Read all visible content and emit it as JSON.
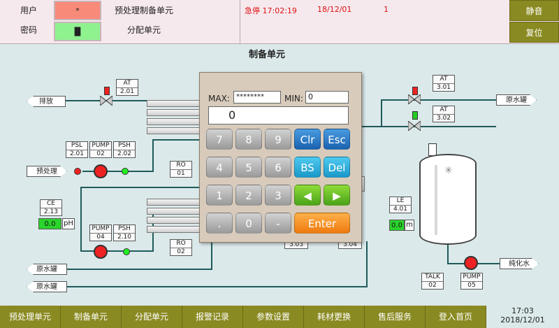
{
  "header": {
    "user_label": "用户",
    "user_value": "*",
    "password_label": "密码",
    "password_value": "█",
    "pre_unit_label": "预处理制备单元",
    "dist_unit_label": "分配单元",
    "alarm_text": "急停 17:02:19",
    "alarm_date": "18/12/01",
    "alarm_count": "1",
    "mute_button": "静音",
    "reset_button": "复位"
  },
  "process": {
    "title": "制备单元",
    "tags": {
      "drain": "排放",
      "pretreat": "预处理",
      "raw_tank_1": "原水罐",
      "raw_tank_2": "原水罐",
      "raw_tank_right": "原水罐",
      "pure_water": "纯化水"
    },
    "instruments": {
      "at_1": {
        "name": "AT",
        "value": "2.01"
      },
      "psl": {
        "name": "PSL",
        "value": "2.01"
      },
      "pump_02": {
        "name": "PUMP",
        "value": "02"
      },
      "psh_202": {
        "name": "PSH",
        "value": "2.02"
      },
      "ro_01": {
        "name": "RO",
        "value": "01"
      },
      "ce": {
        "name": "CE",
        "value": "2.13"
      },
      "pump_04": {
        "name": "PUMP",
        "value": "04"
      },
      "psh_210": {
        "name": "PSH",
        "value": "2.10"
      },
      "ro_02": {
        "name": "RO",
        "value": "02"
      },
      "at_301": {
        "name": "AT",
        "value": "3.01"
      },
      "at_302": {
        "name": "AT",
        "value": "3.02"
      },
      "le": {
        "name": "LE",
        "value": "4.01"
      },
      "talk": {
        "name": "TALK",
        "value": "02"
      },
      "pump_05": {
        "name": "PUMP",
        "value": "05"
      },
      "partial_303": "3.03",
      "partial_304": "3.04"
    },
    "ce_value": "0.0",
    "ce_unit": "pH",
    "le_value": "0.0",
    "le_unit": "m"
  },
  "keypad": {
    "max_label": "MAX:",
    "max_value": "********",
    "min_label": "MIN:",
    "min_value": "0",
    "display_value": "0",
    "keys": {
      "k7": "7",
      "k8": "8",
      "k9": "9",
      "clr": "Clr",
      "esc": "Esc",
      "k4": "4",
      "k5": "5",
      "k6": "6",
      "bs": "BS",
      "del": "Del",
      "k1": "1",
      "k2": "2",
      "k3": "3",
      "left": "◀",
      "right": "▶",
      "dot": ".",
      "k0": "0",
      "minus": "-",
      "enter": "Enter"
    }
  },
  "nav": {
    "items": [
      "预处理单元",
      "制备单元",
      "分配单元",
      "报警记录",
      "参数设置",
      "耗材更换",
      "售后服务",
      "登入首页"
    ],
    "time": "17:03",
    "date": "2018/12/01"
  },
  "colors": {
    "accent": "#8a8a22",
    "header_bg": "#f6e9ee",
    "canvas_bg": "#dbe9ea",
    "user_field": "#f88a7a",
    "password_field": "#8ff28f"
  }
}
